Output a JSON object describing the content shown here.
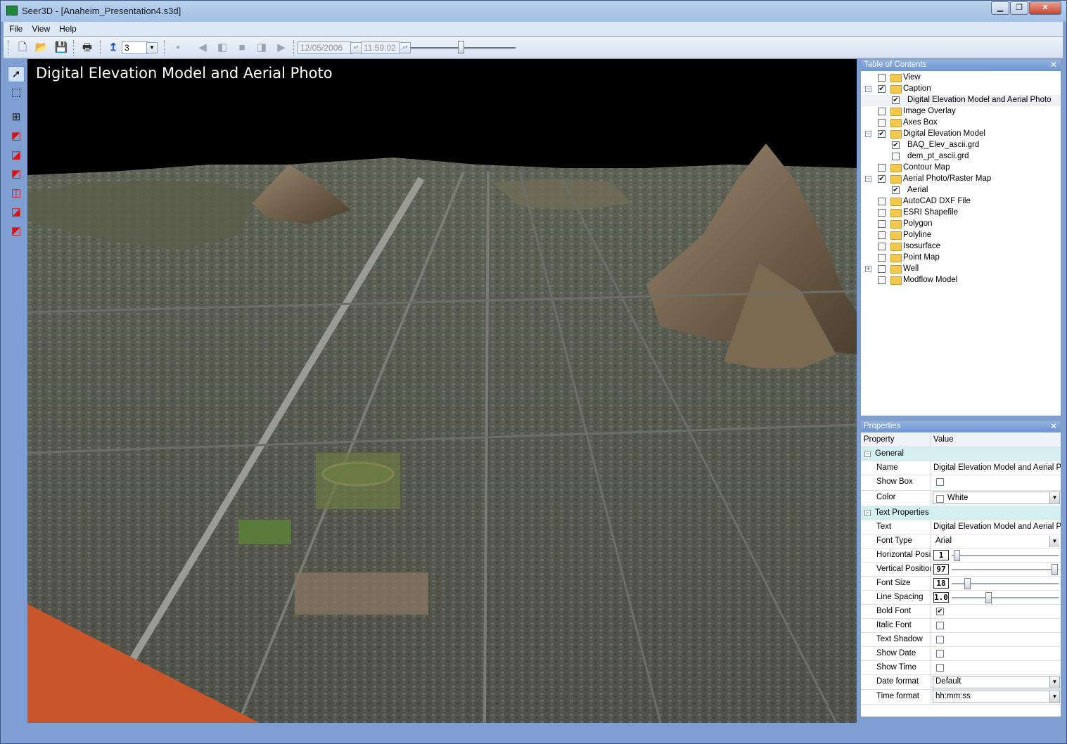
{
  "window": {
    "title": "Seer3D - [Anaheim_Presentation4.s3d]",
    "minimize": "▁",
    "restore": "❐",
    "close": "✕"
  },
  "menu": [
    "File",
    "View",
    "Help"
  ],
  "toolbar": {
    "layer_value": "3",
    "date": "12/05/2006",
    "time": "11:59:02",
    "time_slider_fraction": 0.48
  },
  "viewport": {
    "caption": "Digital Elevation Model and Aerial Photo",
    "accent_color": "#c8562a"
  },
  "toc": {
    "title": "Table of Contents",
    "close": "✕",
    "items": [
      {
        "label": "View",
        "checked": false,
        "expander": "",
        "level": 0,
        "folder": true
      },
      {
        "label": "Caption",
        "checked": true,
        "expander": "−",
        "level": 0,
        "folder": true
      },
      {
        "label": "Digital Elevation Model and Aerial Photo",
        "checked": true,
        "expander": "",
        "level": 1,
        "folder": false,
        "selected": true
      },
      {
        "label": "Image Overlay",
        "checked": false,
        "expander": "",
        "level": 0,
        "folder": true
      },
      {
        "label": "Axes Box",
        "checked": false,
        "expander": "",
        "level": 0,
        "folder": true
      },
      {
        "label": "Digital Elevation Model",
        "checked": true,
        "expander": "−",
        "level": 0,
        "folder": true
      },
      {
        "label": "BAQ_Elev_ascii.grd",
        "checked": true,
        "expander": "",
        "level": 1,
        "folder": false
      },
      {
        "label": "dem_pt_ascii.grd",
        "checked": false,
        "expander": "",
        "level": 1,
        "folder": false
      },
      {
        "label": "Contour Map",
        "checked": false,
        "expander": "",
        "level": 0,
        "folder": true
      },
      {
        "label": "Aerial Photo/Raster Map",
        "checked": true,
        "expander": "−",
        "level": 0,
        "folder": true
      },
      {
        "label": "Aerial",
        "checked": true,
        "expander": "",
        "level": 1,
        "folder": false
      },
      {
        "label": "AutoCAD DXF File",
        "checked": false,
        "expander": "",
        "level": 0,
        "folder": true
      },
      {
        "label": "ESRI Shapefile",
        "checked": false,
        "expander": "",
        "level": 0,
        "folder": true
      },
      {
        "label": "Polygon",
        "checked": false,
        "expander": "",
        "level": 0,
        "folder": true
      },
      {
        "label": "Polyline",
        "checked": false,
        "expander": "",
        "level": 0,
        "folder": true
      },
      {
        "label": "Isosurface",
        "checked": false,
        "expander": "",
        "level": 0,
        "folder": true
      },
      {
        "label": "Point Map",
        "checked": false,
        "expander": "",
        "level": 0,
        "folder": true
      },
      {
        "label": "Well",
        "checked": false,
        "expander": "+",
        "level": 0,
        "folder": true
      },
      {
        "label": "Modflow Model",
        "checked": false,
        "expander": "",
        "level": 0,
        "folder": true
      }
    ]
  },
  "properties": {
    "title": "Properties",
    "close": "✕",
    "col_property": "Property",
    "col_value": "Value",
    "cat_general": "General",
    "cat_text": "Text Properties",
    "collapse": "−",
    "rows": {
      "name": {
        "label": "Name",
        "value": "Digital Elevation Model and Aerial Photo"
      },
      "show_box": {
        "label": "Show Box",
        "checked": false
      },
      "color": {
        "label": "Color",
        "value": "White"
      },
      "text": {
        "label": "Text",
        "value": "Digital Elevation Model and Aerial Photo"
      },
      "font_type": {
        "label": "Font Type",
        "value": "Arial"
      },
      "horizontal": {
        "label": "Horizontal Positi",
        "lcd": "1",
        "fraction": 0.02
      },
      "vertical": {
        "label": "Vertical Position",
        "lcd": "97",
        "fraction": 0.97
      },
      "font_size": {
        "label": "Font Size",
        "lcd": "18",
        "fraction": 0.12
      },
      "line_spacing": {
        "label": "Line Spacing",
        "lcd": "1.0",
        "fraction": 0.33
      },
      "bold": {
        "label": "Bold Font",
        "checked": true
      },
      "italic": {
        "label": "Italic Font",
        "checked": false
      },
      "shadow": {
        "label": "Text Shadow",
        "checked": false
      },
      "show_date": {
        "label": "Show Date",
        "checked": false
      },
      "show_time": {
        "label": "Show Time",
        "checked": false
      },
      "date_format": {
        "label": "Date format",
        "value": "Default"
      },
      "time_format": {
        "label": "Time format",
        "value": "hh:mm:ss"
      }
    }
  }
}
